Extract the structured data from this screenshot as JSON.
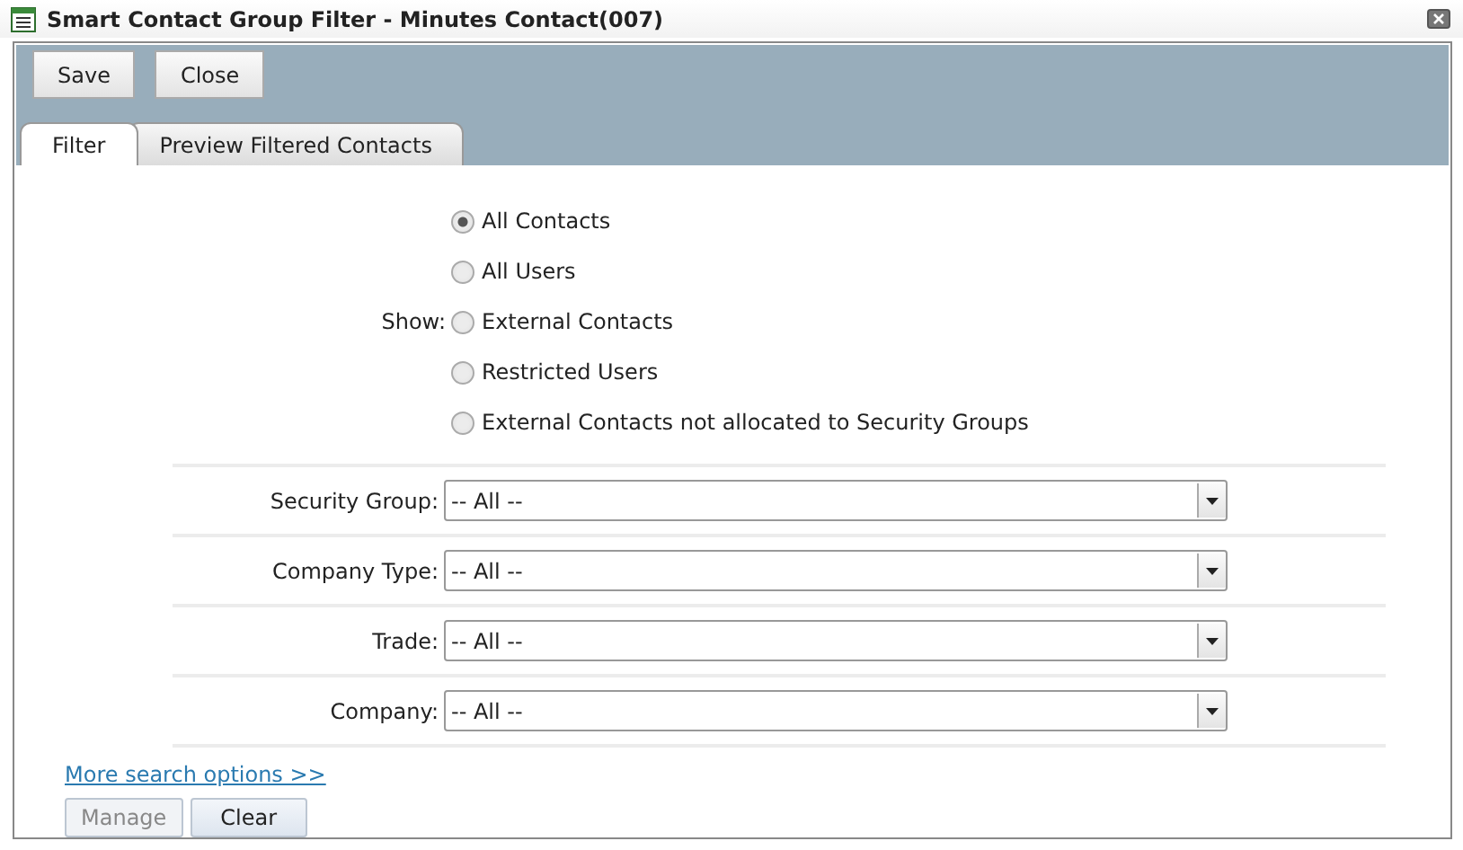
{
  "window": {
    "title": "Smart Contact Group Filter - Minutes Contact(007)"
  },
  "toolbar": {
    "buttons": [
      "Save",
      "Close"
    ]
  },
  "tabs": [
    {
      "label": "Filter",
      "selected": true
    },
    {
      "label": "Preview Filtered Contacts",
      "selected": false
    }
  ],
  "show": {
    "label": "Show:",
    "options": [
      {
        "label": "All Contacts",
        "selected": true
      },
      {
        "label": "All Users",
        "selected": false
      },
      {
        "label": "External Contacts",
        "selected": false
      },
      {
        "label": "Restricted Users",
        "selected": false
      },
      {
        "label": "External Contacts not allocated to Security Groups",
        "selected": false
      }
    ]
  },
  "fields": [
    {
      "label": "Security Group:",
      "value": "-- All --"
    },
    {
      "label": "Company Type:",
      "value": "-- All --"
    },
    {
      "label": "Trade:",
      "value": "-- All --"
    },
    {
      "label": "Company:",
      "value": "-- All --"
    }
  ],
  "more_link": "More search options >>",
  "footer_buttons": [
    {
      "label": "Manage",
      "disabled": true
    },
    {
      "label": "Clear",
      "disabled": false
    }
  ]
}
